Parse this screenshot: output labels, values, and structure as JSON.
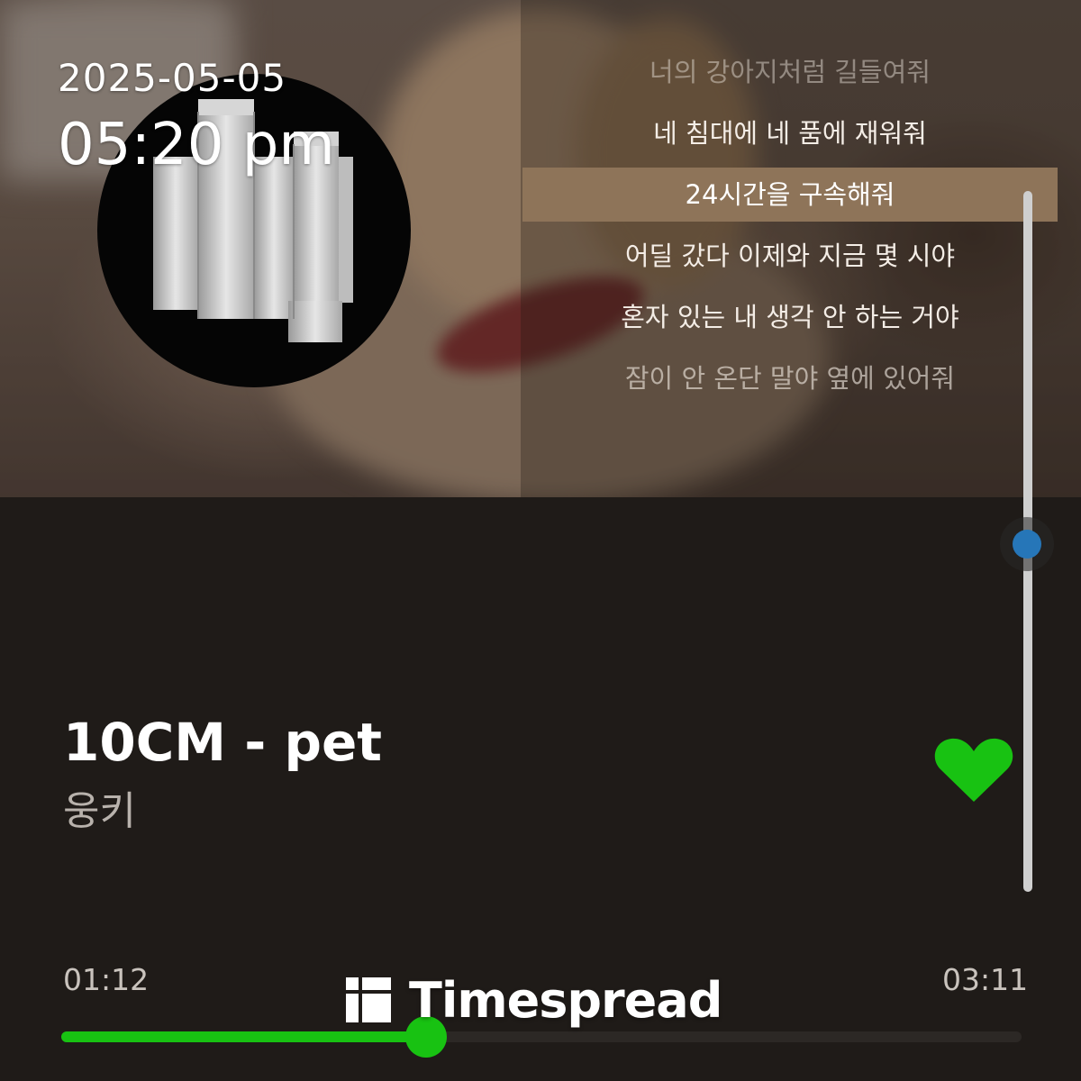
{
  "status": {
    "date": "2025-05-05",
    "time": "05:20 pm"
  },
  "lyrics": {
    "lines": [
      "너의 강아지처럼 길들여줘",
      "네 침대에 네 품에 재워줘",
      "24시간을 구속해줘",
      "어딜 갔다 이제와 지금 몇 시야",
      "혼자 있는 내 생각 안 하는 거야",
      "잠이 안 온단 말야 옆에 있어줘"
    ],
    "active_index": 2,
    "scroll_position": 0.5
  },
  "track": {
    "title": "10CM - pet",
    "artist": "웅키",
    "liked": true
  },
  "playback": {
    "elapsed": "01:12",
    "total": "03:11",
    "progress": 0.38
  },
  "watermark": {
    "text": "Timespread"
  },
  "colors": {
    "accent": "#18c212",
    "active_lyric_bg": "#8e7459",
    "scroll_thumb": "#2676b8",
    "background": "#1f1b18"
  },
  "icons": {
    "like": "heart-icon",
    "album": "album-art",
    "logo": "timespread-logo-icon"
  }
}
